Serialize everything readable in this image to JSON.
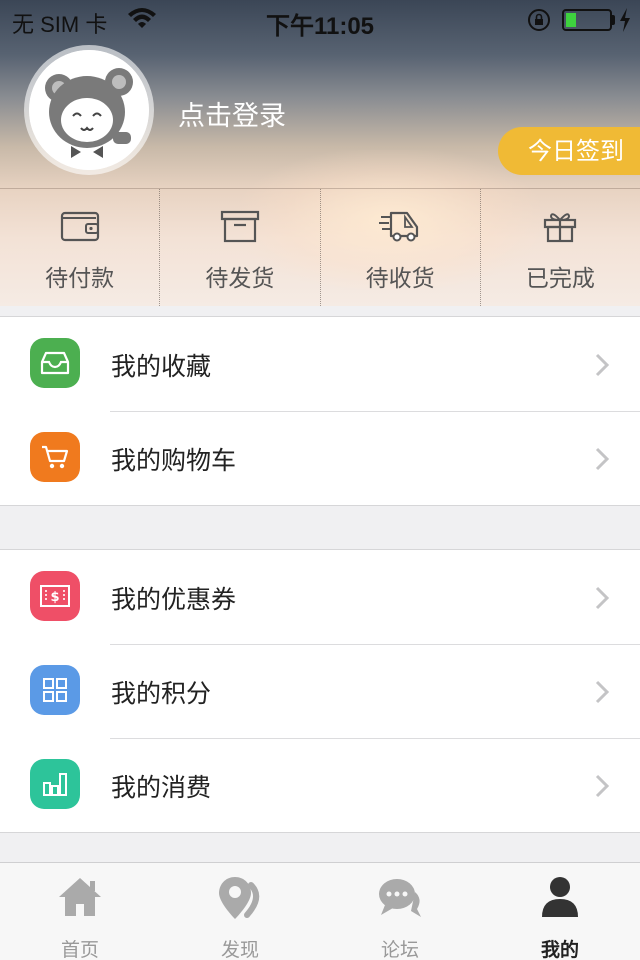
{
  "status_bar": {
    "carrier": "无 SIM 卡",
    "time": "下午11:05"
  },
  "profile": {
    "login_text": "点击登录",
    "checkin_label": "今日签到"
  },
  "orders": [
    {
      "label": "待付款",
      "icon": "wallet-icon"
    },
    {
      "label": "待发货",
      "icon": "box-icon"
    },
    {
      "label": "待收货",
      "icon": "delivery-truck-icon"
    },
    {
      "label": "已完成",
      "icon": "gift-icon"
    }
  ],
  "menu_group_1": [
    {
      "label": "我的收藏",
      "icon": "inbox-tray-icon",
      "color": "#4caf50"
    },
    {
      "label": "我的购物车",
      "icon": "shopping-cart-icon",
      "color": "#f07a1e"
    }
  ],
  "menu_group_2": [
    {
      "label": "我的优惠券",
      "icon": "coupon-icon",
      "color": "#ef4f67"
    },
    {
      "label": "我的积分",
      "icon": "grid-icon",
      "color": "#5b9ae6"
    },
    {
      "label": "我的消费",
      "icon": "bar-chart-icon",
      "color": "#2dc49a"
    }
  ],
  "tabbar": [
    {
      "label": "首页",
      "icon": "home-icon",
      "active": false
    },
    {
      "label": "发现",
      "icon": "location-pin-icon",
      "active": false
    },
    {
      "label": "论坛",
      "icon": "chat-bubbles-icon",
      "active": false
    },
    {
      "label": "我的",
      "icon": "user-icon",
      "active": true
    }
  ],
  "colors": {
    "accent": "#f0ba35",
    "tab_inactive": "#999999",
    "tab_active": "#333333"
  }
}
